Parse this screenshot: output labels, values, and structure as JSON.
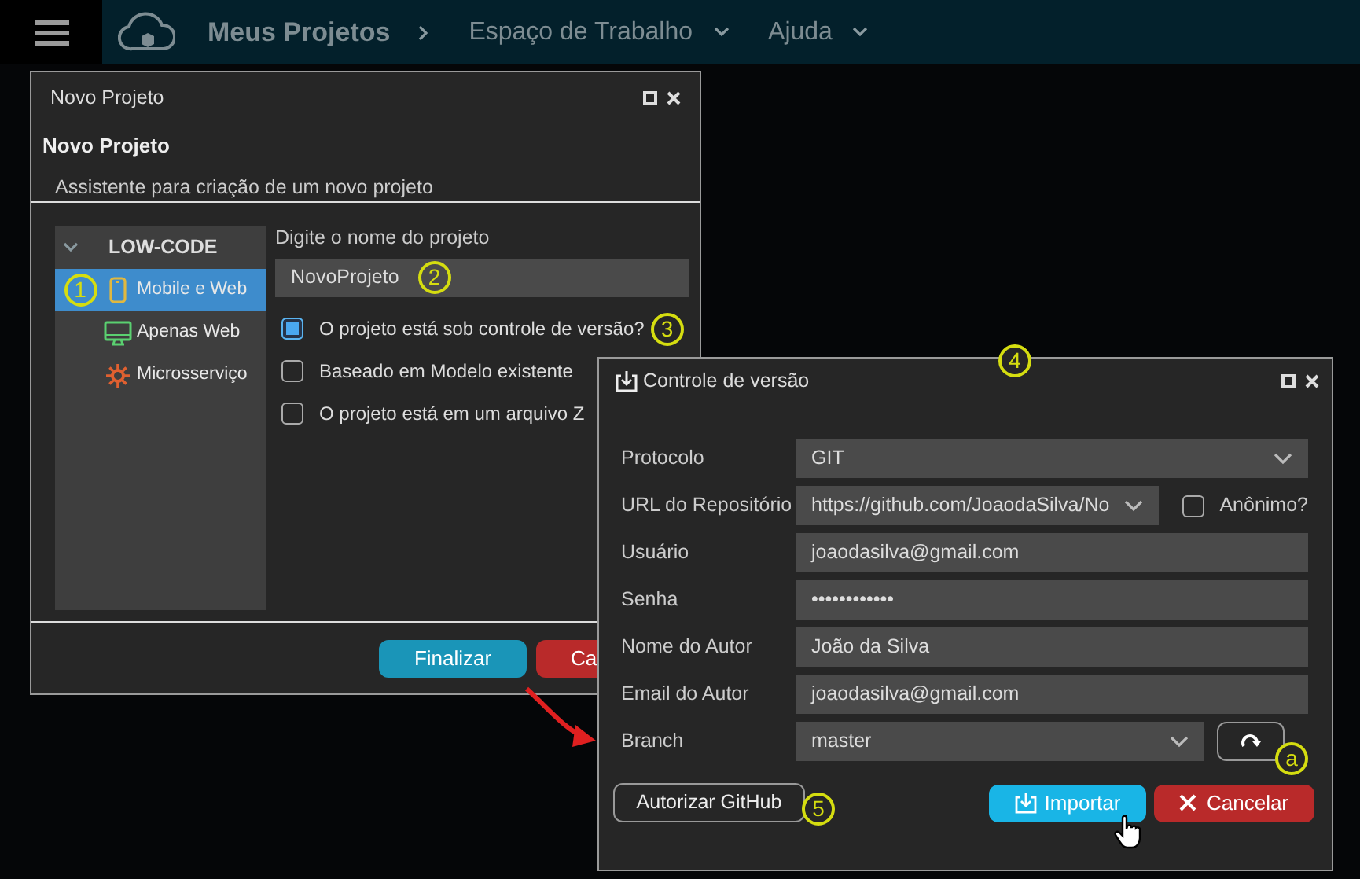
{
  "navbar": {
    "items": [
      {
        "label": "Meus Projetos",
        "kind": "title"
      },
      {
        "label": "Espaço de Trabalho",
        "kind": "menu"
      },
      {
        "label": "Ajuda",
        "kind": "menu"
      }
    ]
  },
  "project_window": {
    "title": "Novo Projeto",
    "heading": "Novo Projeto",
    "subtitle": "Assistente para criação de um novo projeto",
    "tree": {
      "group": "LOW-CODE",
      "expanded": true,
      "items": [
        {
          "label": "Mobile e Web",
          "kind": "mobile",
          "selected": true,
          "callout": "1"
        },
        {
          "label": "Apenas Web",
          "kind": "web",
          "selected": false
        },
        {
          "label": "Microsserviço",
          "kind": "service",
          "selected": false
        }
      ]
    },
    "name_field": {
      "label": "Digite o nome do projeto",
      "value": "NovoProjeto",
      "callout": "2"
    },
    "options": [
      {
        "label": "O projeto está sob controle de versão?",
        "checked": true,
        "callout": "3"
      },
      {
        "label": "Baseado em Modelo existente",
        "checked": false
      },
      {
        "label": "O projeto está em um arquivo Z",
        "checked": false
      }
    ],
    "buttons": [
      {
        "label": "Finalizar",
        "kind": "primary"
      },
      {
        "label": "Ca",
        "kind": "danger"
      }
    ]
  },
  "vcs_dialog": {
    "title": "Controle de versão",
    "callout": "4",
    "fields": [
      {
        "label": "Protocolo",
        "kind": "select",
        "value": "GIT"
      },
      {
        "label": "URL do Repositório",
        "kind": "select-check",
        "value": "https://github.com/JoaodaSilva/No",
        "check_label": "Anônimo?",
        "checked": false
      },
      {
        "label": "Usuário",
        "kind": "text",
        "value": "joaodasilva@gmail.com"
      },
      {
        "label": "Senha",
        "kind": "text",
        "value": "••••••••••••"
      },
      {
        "label": "Nome do Autor",
        "kind": "text",
        "value": "João da Silva"
      },
      {
        "label": "Email do Autor",
        "kind": "text",
        "value": "joaodasilva@gmail.com"
      },
      {
        "label": "Branch",
        "kind": "select-refresh",
        "value": "master",
        "callout": "a"
      }
    ],
    "authorize": {
      "label": "Autorizar GitHub",
      "callout": "5"
    },
    "buttons": [
      {
        "label": "Importar",
        "kind": "import"
      },
      {
        "label": "Cancelar",
        "kind": "cancel"
      }
    ]
  }
}
